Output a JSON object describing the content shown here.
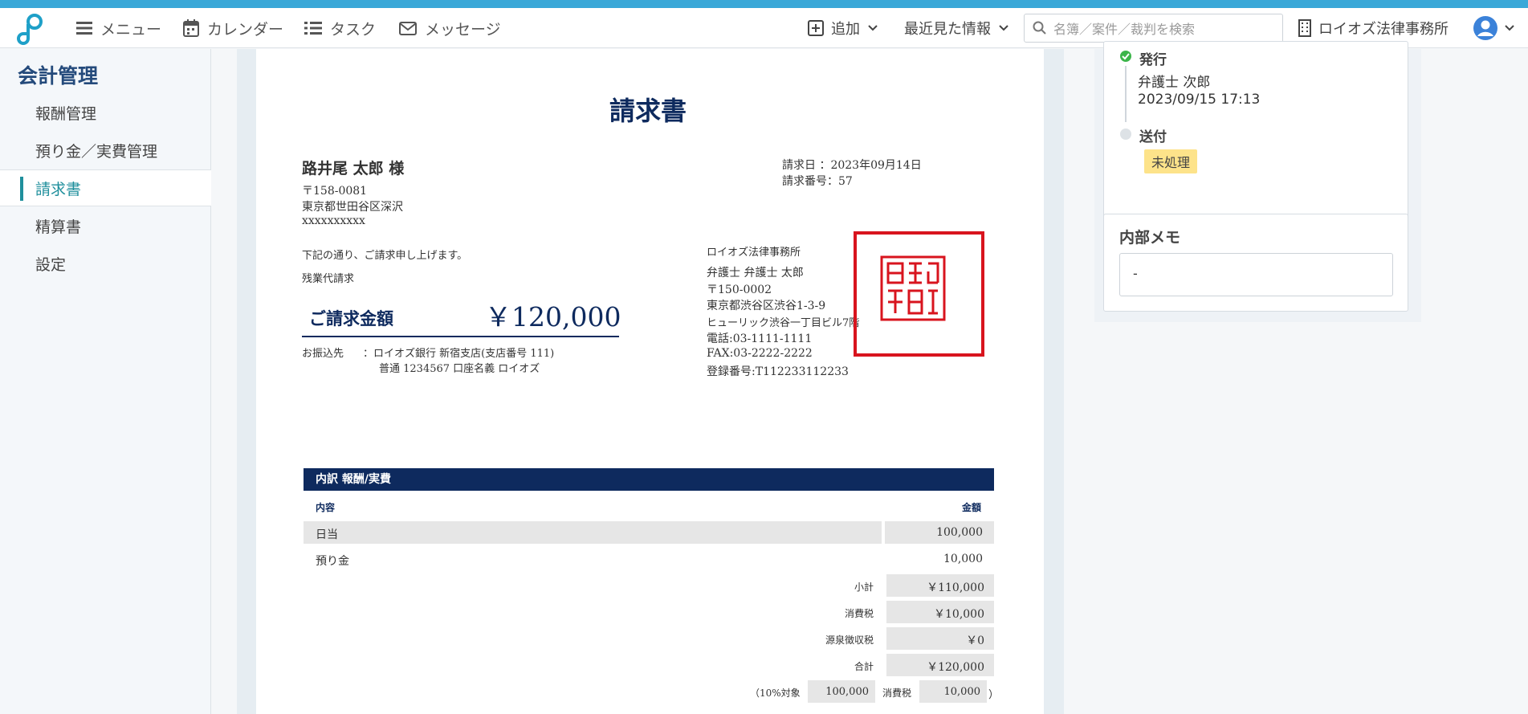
{
  "topbar": {
    "menu": "メニュー",
    "calendar": "カレンダー",
    "task": "タスク",
    "message": "メッセージ",
    "add": "追加",
    "recent": "最近見た情報",
    "search_placeholder": "名簿／案件／裁判を検索",
    "firm": "ロイオズ法律事務所"
  },
  "sidebar": {
    "title": "会計管理",
    "items": [
      "報酬管理",
      "預り金／実費管理",
      "請求書",
      "精算書",
      "設定"
    ],
    "active_index": 2
  },
  "invoice": {
    "title": "請求書",
    "client_name": "路井尾 太郎 様",
    "client_zip": "〒158-0081",
    "client_address": "東京都世田谷区深沢",
    "client_address2": "xxxxxxxxxx",
    "date_label": "請求日 ：2023年09月14日",
    "number_label": "請求番号：57",
    "intro": "下記の通り、ご請求申し上げます。",
    "subject": "残業代請求",
    "amount_label": "ご請求金額",
    "amount": "￥120,000",
    "bank_label": "お振込先",
    "bank_line1": "：ロイオズ銀行 新宿支店(支店番号 111)",
    "bank_line2": "普通 1234567 口座名義 ロイオズ",
    "firm_name": "ロイオズ法律事務所",
    "lawyer": "弁護士 弁護士 太郎",
    "firm_zip": "〒150-0002",
    "firm_address": "東京都渋谷区渋谷1-3-9",
    "firm_building": "ヒューリック渋谷一丁目ビル7階",
    "tel": "電話:03-1111-1111",
    "fax": "FAX:03-2222-2222",
    "reg_no": "登録番号:T112233112233",
    "seal_text": "ロイオズ法律事務所",
    "table_header": "内訳 報酬/実費",
    "col_content": "内容",
    "col_amount": "金額",
    "rows": [
      {
        "name": "日当",
        "amount": "100,000"
      },
      {
        "name": "預り金",
        "amount": "10,000"
      }
    ],
    "subtotal_label": "小計",
    "subtotal": "￥110,000",
    "tax_label": "消費税",
    "tax": "￥10,000",
    "withholding_label": "源泉徴収税",
    "withholding": "￥0",
    "total_label": "合計",
    "total": "￥120,000",
    "breakdown_label": "（10%対象",
    "breakdown_base": "100,000",
    "breakdown_tax_label": "消費税",
    "breakdown_tax": "10,000",
    "breakdown_close": "）"
  },
  "status_panel": {
    "issued_label": "発行",
    "issued_by": "弁護士 次郎",
    "issued_at": "2023/09/15 17:13",
    "sent_label": "送付",
    "sent_status": "未処理"
  },
  "memo": {
    "title": "内部メモ",
    "value": "-"
  },
  "colors": {
    "navy": "#0e2a5e",
    "teal": "#1f8f9c",
    "seal_red": "#d8141e",
    "badge": "#fde38a"
  }
}
